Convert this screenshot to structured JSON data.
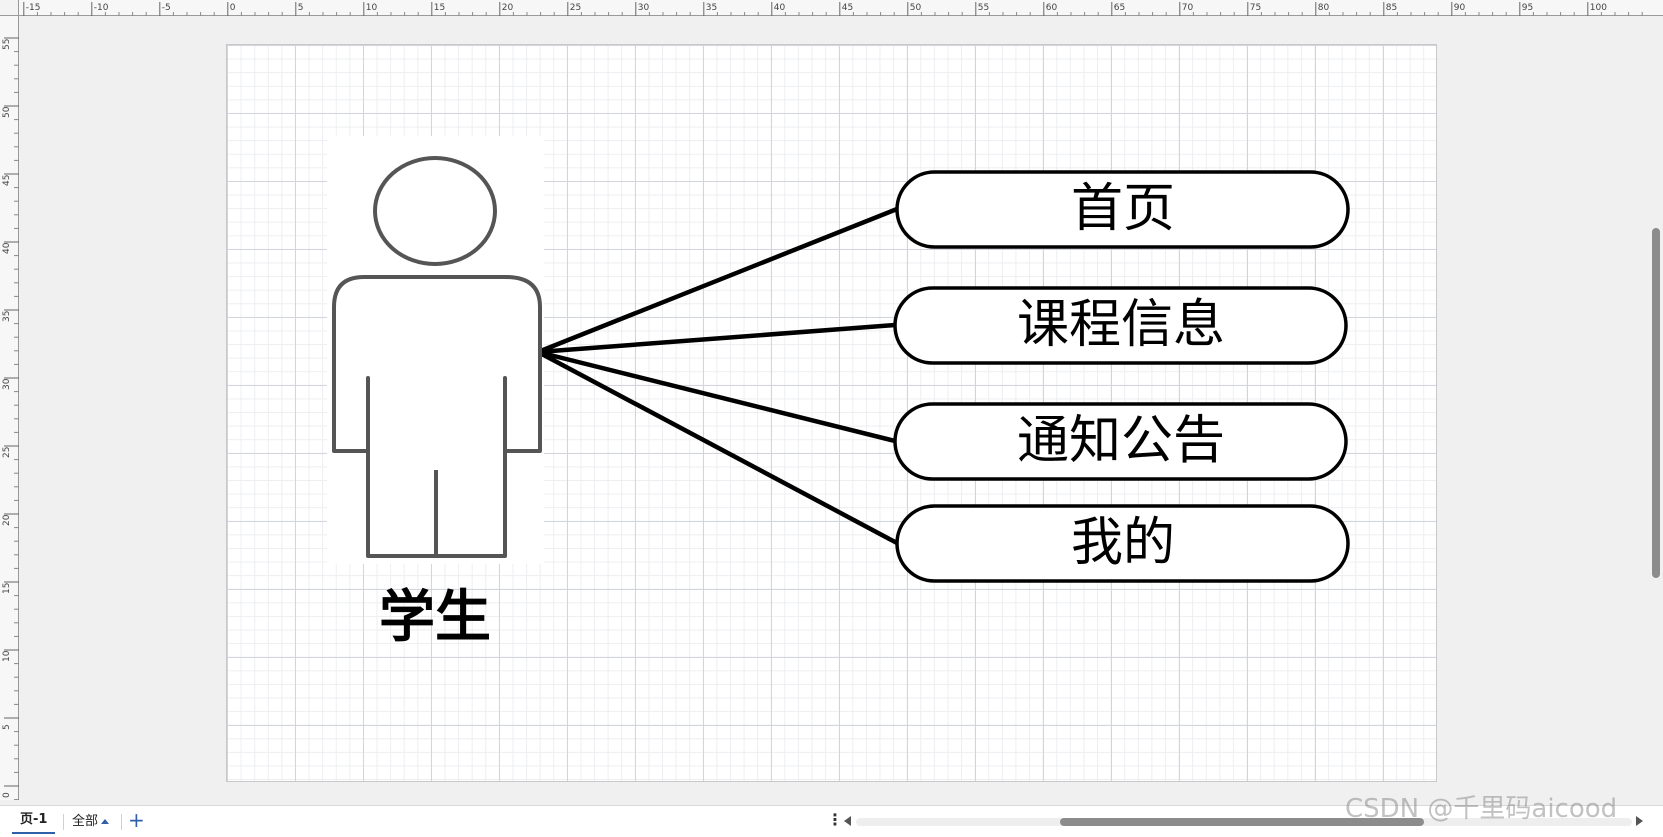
{
  "ruler": {
    "top_ticks": [
      "-15",
      "-10",
      "-5",
      "0",
      "5",
      "10",
      "15",
      "20",
      "25",
      "30",
      "35",
      "40",
      "45",
      "50",
      "55",
      "60",
      "65",
      "70",
      "75",
      "80",
      "85",
      "90",
      "95",
      "100"
    ],
    "left_ticks": [
      "55",
      "50",
      "45",
      "40",
      "35",
      "30",
      "25",
      "20",
      "15",
      "10",
      "5",
      "0"
    ]
  },
  "diagram": {
    "actor": {
      "label": "学生"
    },
    "use_cases": [
      {
        "label": "首页"
      },
      {
        "label": "课程信息"
      },
      {
        "label": "通知公告"
      },
      {
        "label": "我的"
      }
    ],
    "colors": {
      "stroke": "#000000",
      "actor_stroke": "#555555",
      "grid_major": "#d2d6dc",
      "grid_minor": "#eceef1"
    }
  },
  "bottom_bar": {
    "page_tab": "页-1",
    "all_pages": "全部",
    "add_page_icon": "plus-icon",
    "more_icon": "vertical-dots-icon"
  },
  "watermark": "CSDN @千里码aicood"
}
